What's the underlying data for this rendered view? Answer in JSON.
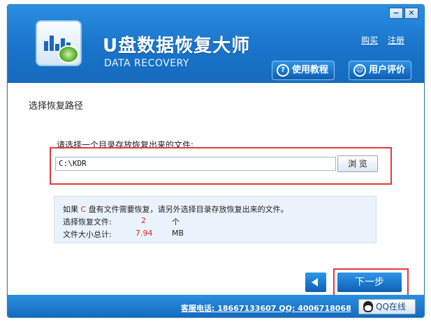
{
  "window": {
    "minimize": "−",
    "close": "✕"
  },
  "header": {
    "title": "U盘数据恢复大师",
    "subtitle": "DATA RECOVERY",
    "links": {
      "buy": "购买",
      "register": "注册"
    },
    "buttons": {
      "tutorial": "使用教程",
      "review": "用户评价"
    }
  },
  "main": {
    "section_title": "选择恢复路径",
    "path_label": "请选择一个目录存放恢复出来的文件:",
    "path_value": "C:\\KDR",
    "browse": "浏 览",
    "info": {
      "line1_prefix": "如果",
      "drive": "C",
      "line1_suffix": "盘有文件需要恢复，请另外选择目录存放恢复出来的文件。",
      "selected_label": "选择恢复文件:",
      "selected_count": "2",
      "selected_unit": "个",
      "size_label": "文件大小总计:",
      "size_value": "7.94",
      "size_unit": "MB"
    },
    "next": "下一步"
  },
  "footer": {
    "contact": "客服电话: 18667133607 QQ: 4006718068",
    "qq_online": "QQ在线"
  }
}
